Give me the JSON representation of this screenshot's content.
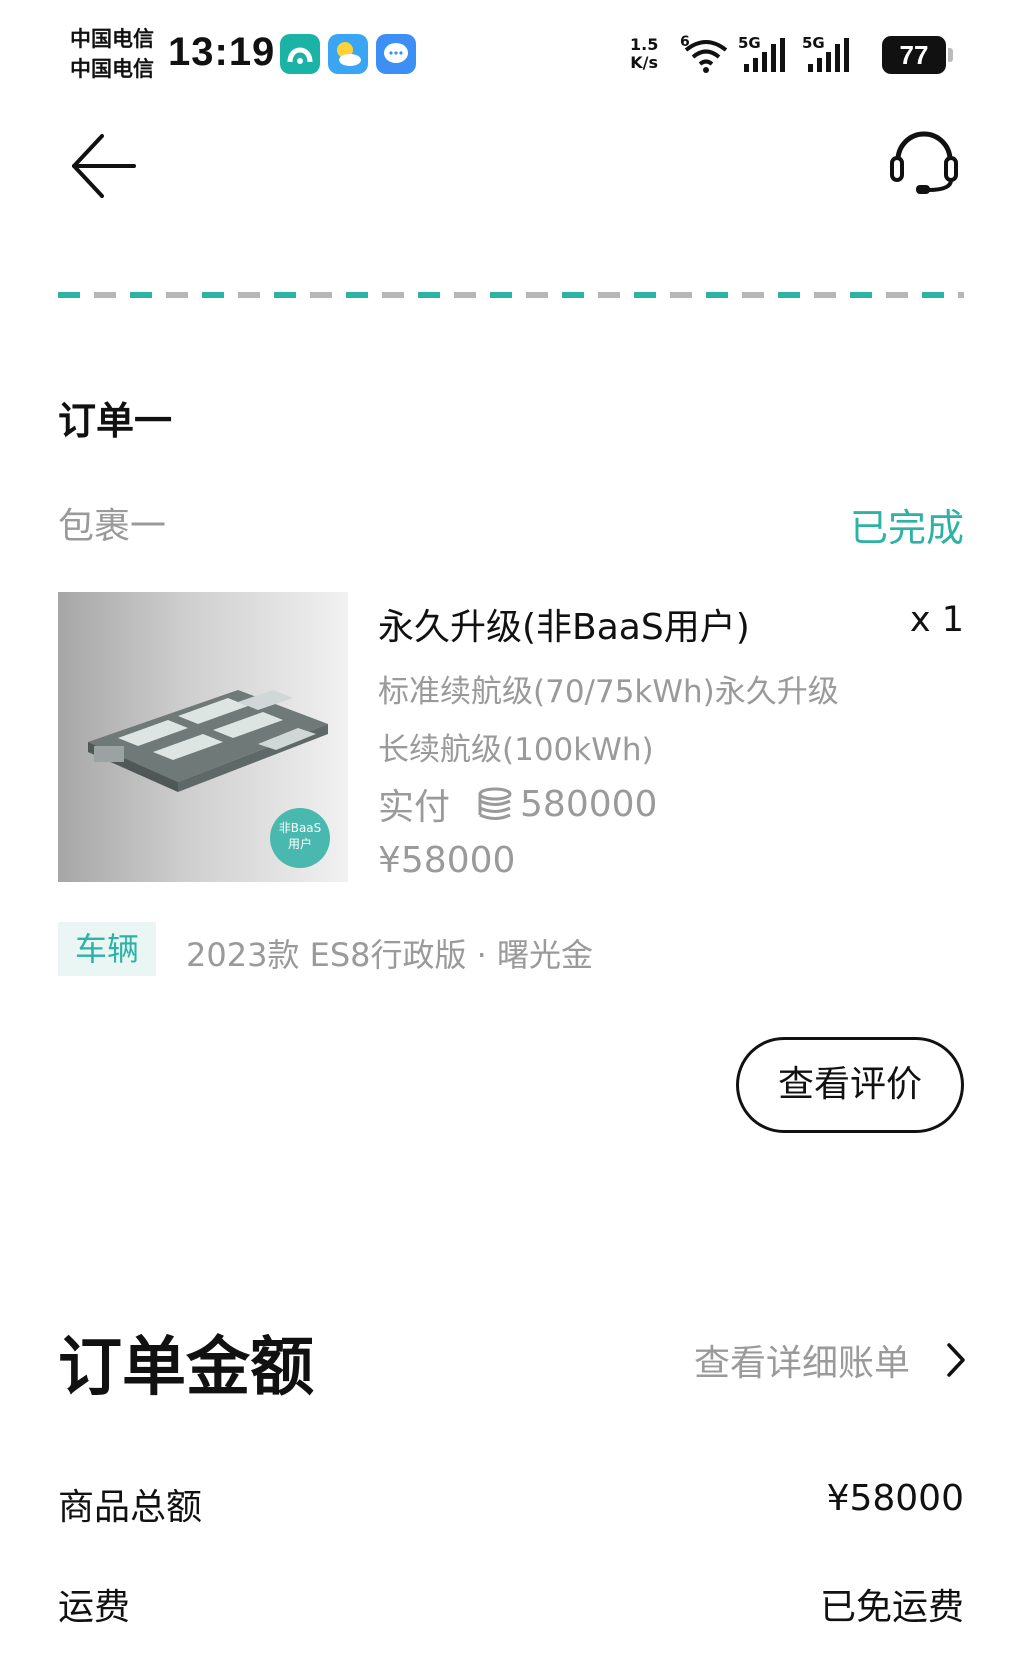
{
  "status_bar": {
    "carrier_1": "中国电信",
    "carrier_2": "中国电信",
    "time": "13:19",
    "app_icons": [
      "nio-app-icon",
      "weather-icon",
      "message-icon"
    ],
    "net_speed_value": "1.5",
    "net_speed_unit": "K/s",
    "wifi_label": "6",
    "signal_1": "5G",
    "signal_2": "5G",
    "battery": "77"
  },
  "header": {
    "back_icon": "arrow-left-icon",
    "support_icon": "headset-icon"
  },
  "colors": {
    "accent": "#2db3a6",
    "muted": "#9a9a9a",
    "text": "#111111"
  },
  "order": {
    "title": "订单一",
    "package_label": "包裹一",
    "status": "已完成",
    "product": {
      "name": "永久升级(非BaaS用户)",
      "quantity": "x 1",
      "spec_line_1": "标准续航级(70/75kWh)永久升级",
      "spec_line_2": "长续航级(100kWh)",
      "paid_label": "实付",
      "paid_points": "580000",
      "price": "¥58000",
      "image_badge_line_1": "非BaaS",
      "image_badge_line_2": "用户"
    },
    "vehicle_tag": "车辆",
    "vehicle_info": "2023款 ES8行政版 · 曙光金",
    "review_button": "查看评价"
  },
  "amount": {
    "title": "订单金额",
    "detail_link": "查看详细账单",
    "rows": [
      {
        "label": "商品总额",
        "value": "¥58000"
      },
      {
        "label": "运费",
        "value": "已免运费"
      }
    ]
  }
}
